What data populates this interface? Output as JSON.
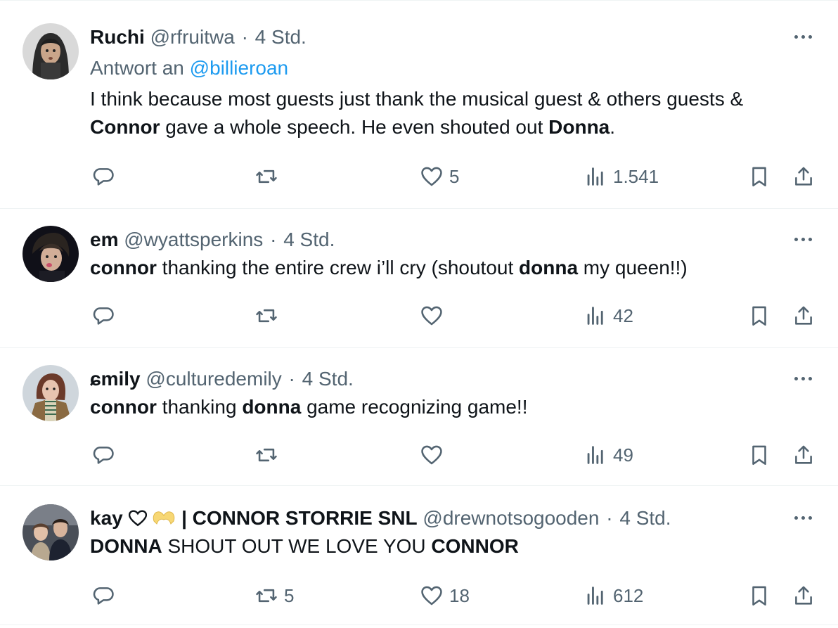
{
  "tweets": [
    {
      "name": "Ruchi",
      "handle": "@rfruitwa",
      "sep": "·",
      "time": "4 Std.",
      "reply_prefix": "Antwort an",
      "reply_mention": "@billieroan",
      "text": [
        {
          "t": "I think because most guests just thank the musical guest & others guests &",
          "b": false
        },
        {
          "t": "\n",
          "b": false
        },
        {
          "t": "Connor",
          "b": true
        },
        {
          "t": " gave a whole speech. He even shouted out ",
          "b": false
        },
        {
          "t": "Donna",
          "b": true
        },
        {
          "t": ".",
          "b": false
        }
      ],
      "stats": {
        "replies": "",
        "retweets": "",
        "likes": "5",
        "views": "1.541"
      }
    },
    {
      "name": "em",
      "handle": "@wyattsperkins",
      "sep": "·",
      "time": "4 Std.",
      "text": [
        {
          "t": "connor",
          "b": true
        },
        {
          "t": " thanking the entire crew i’ll cry (shoutout ",
          "b": false
        },
        {
          "t": "donna",
          "b": true
        },
        {
          "t": " my queen!!)",
          "b": false
        }
      ],
      "stats": {
        "replies": "",
        "retweets": "",
        "likes": "",
        "views": "42"
      }
    },
    {
      "name": "ɕmily",
      "handle": "@culturedemily",
      "sep": "·",
      "time": "4 Std.",
      "text": [
        {
          "t": "connor",
          "b": true
        },
        {
          "t": " thanking ",
          "b": false
        },
        {
          "t": "donna",
          "b": true
        },
        {
          "t": " game recognizing game!!",
          "b": false
        }
      ],
      "stats": {
        "replies": "",
        "retweets": "",
        "likes": "",
        "views": "49"
      }
    },
    {
      "name": "kay",
      "name_suffix": "| CONNOR STORRIE SNL",
      "handle": "@drewnotsogooden",
      "sep": "·",
      "time": "4 Std.",
      "text": [
        {
          "t": "DONNA",
          "b": true
        },
        {
          "t": " SHOUT OUT WE LOVE YOU ",
          "b": false
        },
        {
          "t": "CONNOR",
          "b": true
        }
      ],
      "stats": {
        "replies": "",
        "retweets": "5",
        "likes": "18",
        "views": "612"
      }
    }
  ],
  "colors": {
    "text": "#0f1419",
    "secondary": "#536471",
    "link": "#1d9bf0",
    "divider": "#eff3f4",
    "heart_hands": "#f7d774"
  },
  "icons": [
    "reply-icon",
    "retweet-icon",
    "like-icon",
    "views-icon",
    "bookmark-icon",
    "share-icon",
    "more-icon"
  ]
}
